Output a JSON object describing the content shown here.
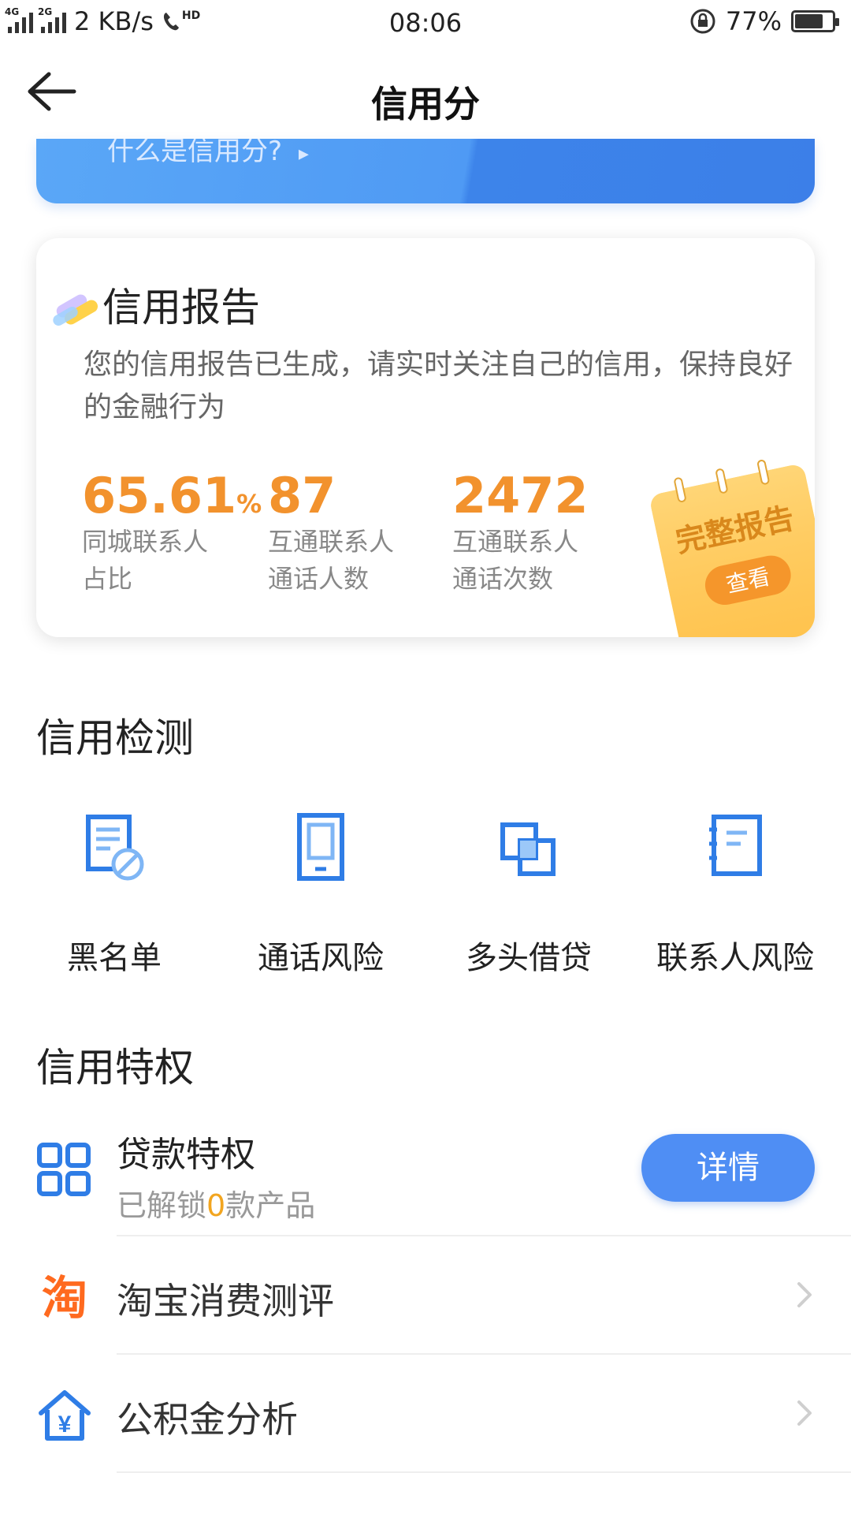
{
  "status_bar": {
    "network_tag_1": "4G",
    "network_tag_2": "2G",
    "speed": "2 KB/s",
    "hd_label": "HD",
    "time": "08:06",
    "battery_percent": "77%",
    "battery_level": 0.77
  },
  "nav": {
    "title": "信用分"
  },
  "banner": {
    "text": "什么是信用分?"
  },
  "report": {
    "title": "信用报告",
    "description": "您的信用报告已生成，请实时关注自己的信用，保持良好的金融行为",
    "stats": [
      {
        "value": "65.61",
        "unit": "%",
        "label_line1": "同城联系人",
        "label_line2": "占比"
      },
      {
        "value": "87",
        "unit": "",
        "label_line1": "互通联系人",
        "label_line2": "通话人数"
      },
      {
        "value": "2472",
        "unit": "",
        "label_line1": "互通联系人",
        "label_line2": "通话次数"
      }
    ],
    "full_report_label": "完整报告",
    "view_label": "查看"
  },
  "detection": {
    "title": "信用检测",
    "items": [
      {
        "label": "黑名单",
        "icon": "blacklist-icon"
      },
      {
        "label": "通话风险",
        "icon": "phone-icon"
      },
      {
        "label": "多头借贷",
        "icon": "overlap-squares-icon"
      },
      {
        "label": "联系人风险",
        "icon": "contact-book-icon"
      }
    ]
  },
  "privileges": {
    "title": "信用特权",
    "loan": {
      "title": "贷款特权",
      "sub_prefix": "已解锁",
      "sub_count": "0",
      "sub_suffix": "款产品",
      "button": "详情"
    },
    "rows": [
      {
        "label": "淘宝消费测评",
        "icon": "taobao-icon",
        "icon_text": "淘"
      },
      {
        "label": "公积金分析",
        "icon": "house-fund-icon",
        "icon_text": "¥"
      }
    ]
  },
  "colors": {
    "accent_blue": "#4f8ef4",
    "icon_blue": "#2f7de6",
    "stat_orange": "#f2922d",
    "taobao_orange": "#ff6a1f"
  }
}
